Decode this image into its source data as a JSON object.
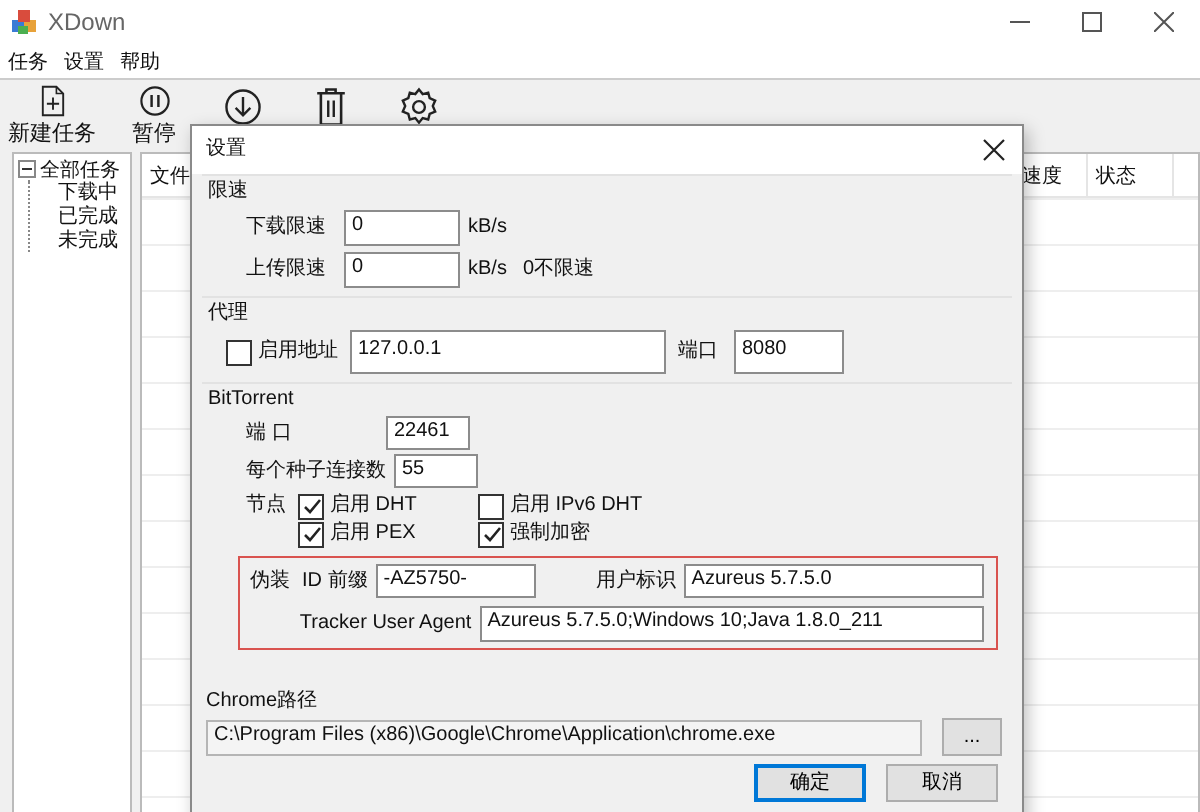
{
  "window": {
    "title": "XDown"
  },
  "menu": [
    {
      "label": "任务"
    },
    {
      "label": "设置"
    },
    {
      "label": "帮助"
    }
  ],
  "toolbar": [
    {
      "kind": "new",
      "label": "新建任务"
    },
    {
      "kind": "pause",
      "label": "暂停"
    },
    {
      "kind": "download"
    },
    {
      "kind": "delete"
    },
    {
      "kind": "settings"
    }
  ],
  "tree": {
    "label": "全部任务",
    "expanded": true,
    "children": [
      {
        "label": "下载中"
      },
      {
        "label": "已完成"
      },
      {
        "label": "未完成"
      }
    ]
  },
  "table": {
    "columns": [
      "文件",
      "速度",
      "状态"
    ]
  },
  "dialog": {
    "title": "设置",
    "speed_limit": {
      "title": "限速",
      "download": {
        "label": "下载限速",
        "value": "0",
        "unit": "kB/s"
      },
      "upload": {
        "label": "上传限速",
        "value": "0",
        "unit": "kB/s",
        "note": "0不限速"
      }
    },
    "proxy": {
      "title": "代理",
      "enable": {
        "label": "启用地址",
        "checked": false
      },
      "address": "127.0.0.1",
      "port_label": "端口",
      "port": "8080"
    },
    "bittorrent": {
      "title": "BitTorrent",
      "port_label": "端 口",
      "port": "22461",
      "conn_label": "每个种子连接数",
      "conn": "55",
      "nodes_label": "节点",
      "options": [
        {
          "label": "启用 DHT",
          "checked": true
        },
        {
          "label": "启用 IPv6 DHT",
          "checked": false
        },
        {
          "label": "启用 PEX",
          "checked": true
        },
        {
          "label": "强制加密",
          "checked": true
        }
      ],
      "disguise": {
        "label": "伪装",
        "id_prefix_label": "ID 前缀",
        "id_prefix": "-AZ5750-",
        "user_id_label": "用户标识",
        "user_id": "Azureus 5.7.5.0",
        "agent_label": "Tracker User Agent",
        "agent": "Azureus 5.7.5.0;Windows 10;Java 1.8.0_211"
      }
    },
    "chrome": {
      "label": "Chrome路径",
      "path": "C:\\Program Files (x86)\\Google\\Chrome\\Application\\chrome.exe",
      "browse": "..."
    },
    "buttons": [
      {
        "label": "确定",
        "default": true
      },
      {
        "label": "取消",
        "default": false
      }
    ]
  }
}
